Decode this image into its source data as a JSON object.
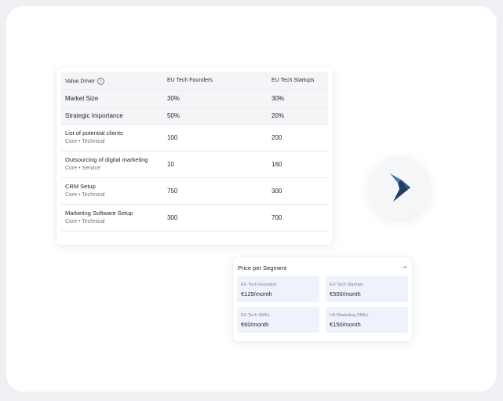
{
  "table": {
    "headers": {
      "driver": "Value Driver",
      "col1": "EU Tech Founders",
      "col2": "EU Tech Startups"
    },
    "metrics": [
      {
        "label": "Market Size",
        "v1": "30%",
        "v2": "30%"
      },
      {
        "label": "Strategic Importance",
        "v1": "50%",
        "v2": "20%"
      }
    ],
    "items": [
      {
        "name": "List of potential clients",
        "sub": "Core • Technical",
        "v1": "100",
        "v2": "200"
      },
      {
        "name": "Outsourcing of digital marketing",
        "sub": "Core • Service",
        "v1": "10",
        "v2": "160"
      },
      {
        "name": "CRM Setup",
        "sub": "Core • Technical",
        "v1": "750",
        "v2": "300"
      },
      {
        "name": "Marketing Software Setup",
        "sub": "Core • Technical",
        "v1": "300",
        "v2": "700"
      }
    ]
  },
  "icons": {
    "info": "info-icon",
    "arrow": "arrow-right-icon",
    "logo": "brand-logo"
  },
  "colors": {
    "logo_dark": "#1f3f66",
    "logo_light": "#3f76b0",
    "segment_bg": "#eef2fb"
  },
  "price": {
    "title": "Price per Segment",
    "arrow": "→",
    "segments": [
      {
        "name": "EU Tech Founders",
        "price": "€129/month"
      },
      {
        "name": "EU Tech Startups",
        "price": "€500/month"
      },
      {
        "name": "EU Tech SMEs",
        "price": "€60/month"
      },
      {
        "name": "US Marketing SMEs",
        "price": "€150/month"
      }
    ]
  }
}
